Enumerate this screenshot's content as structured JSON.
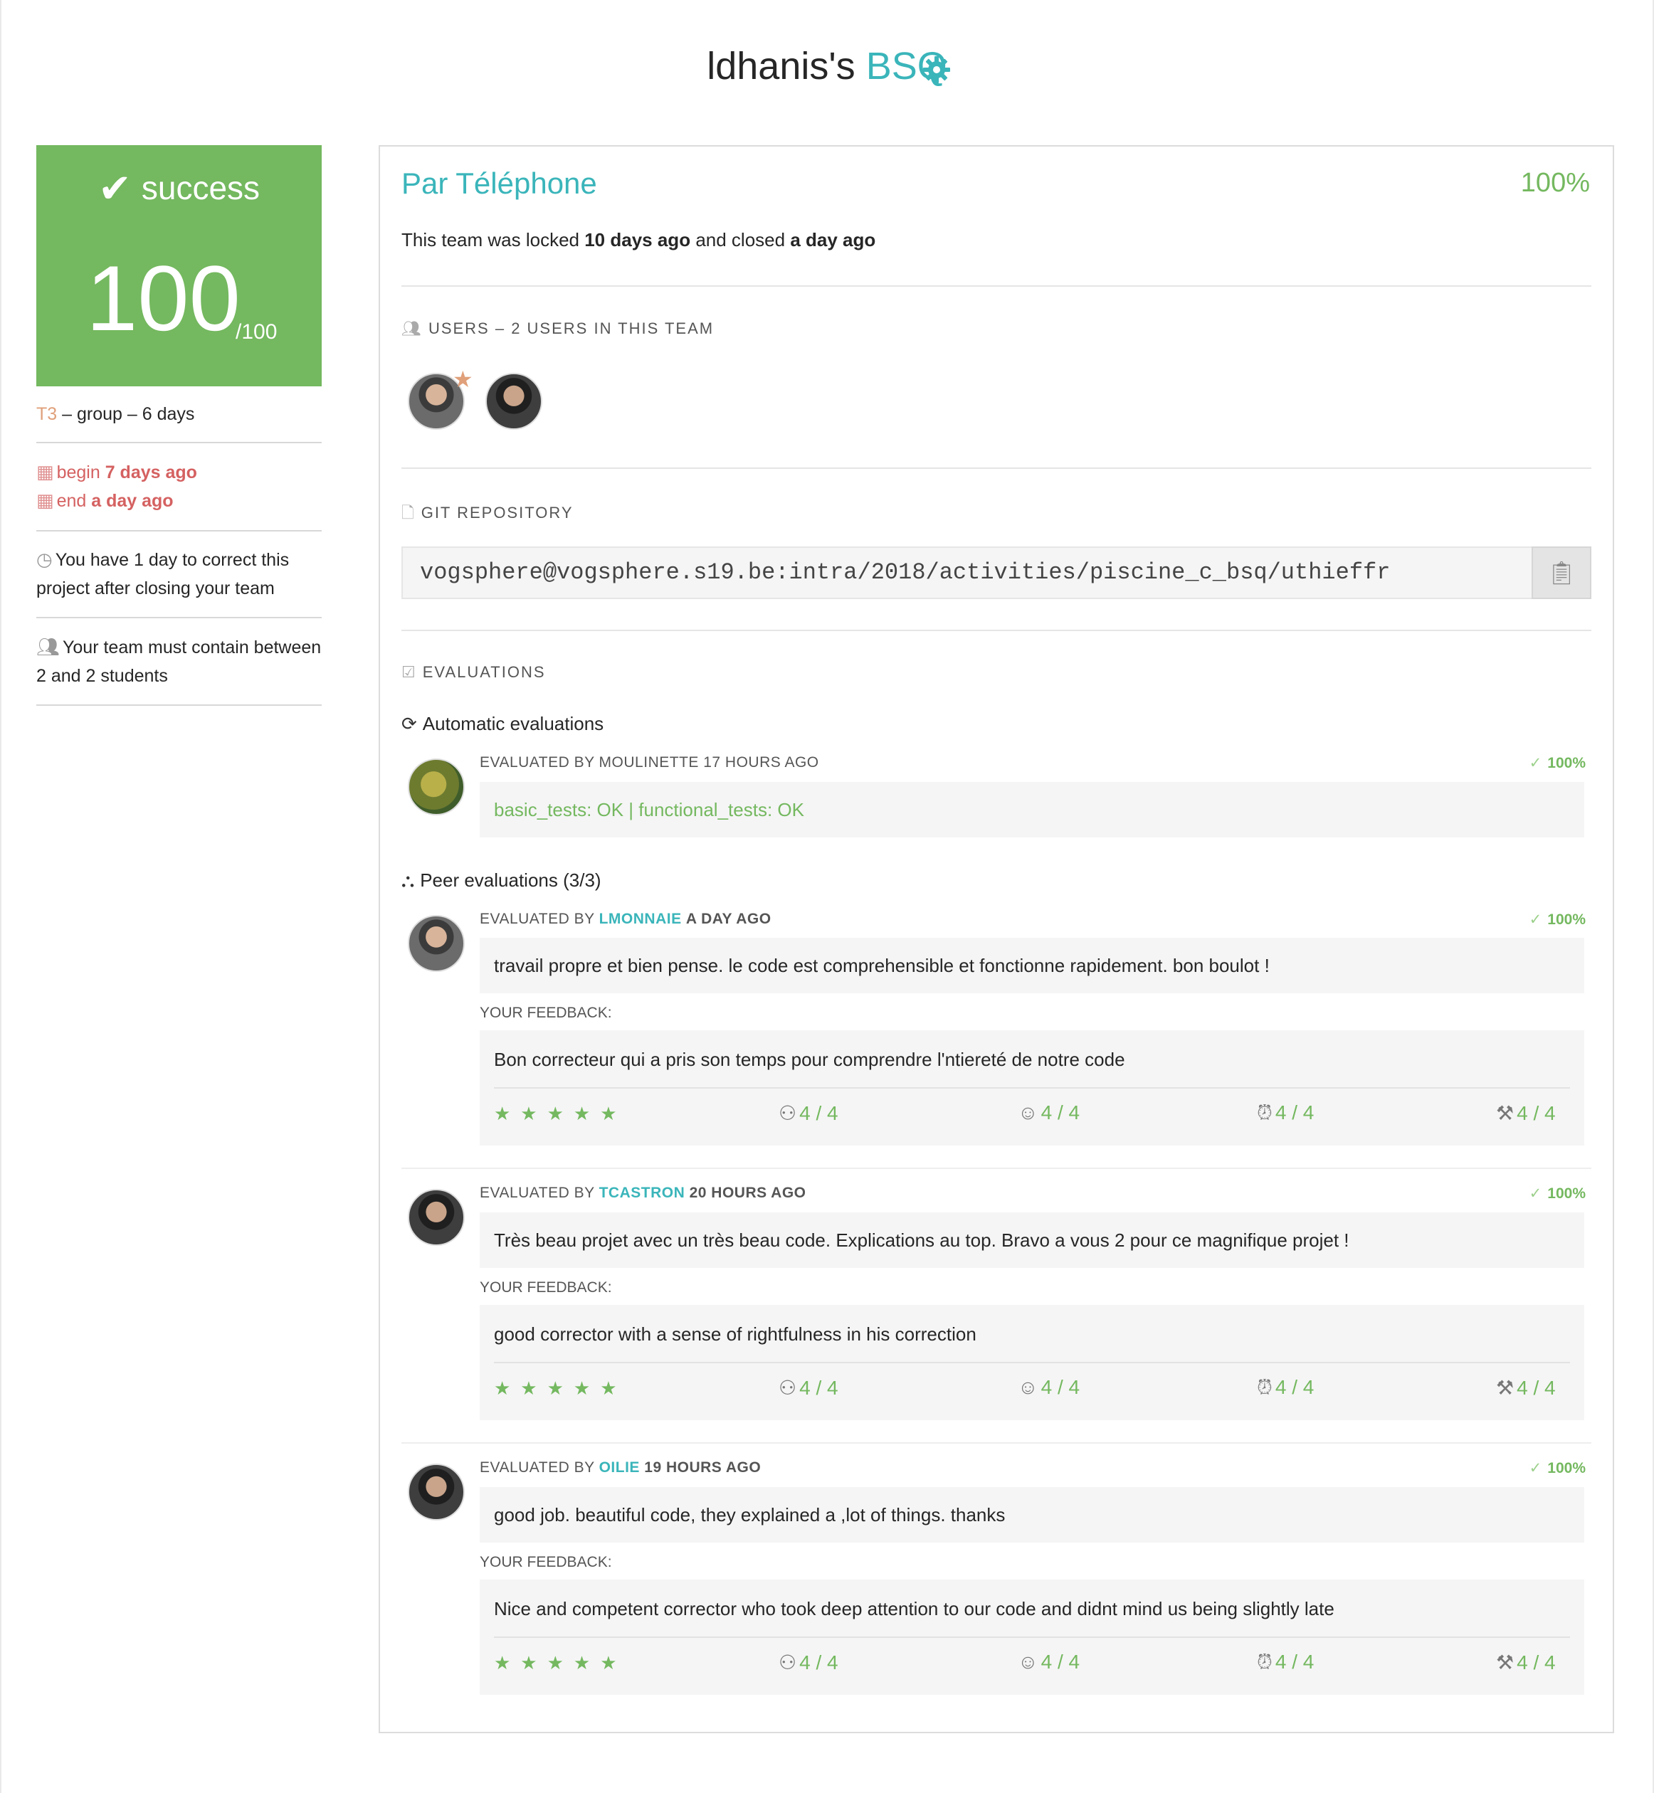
{
  "header": {
    "owner": "ldhanis's",
    "project": "BSQ"
  },
  "left": {
    "status": "success",
    "grade": "100",
    "grade_max": "/100",
    "tier": "T3",
    "meta": " – group – 6 days",
    "begin_label": "begin",
    "begin_value": "7 days ago",
    "end_label": "end",
    "end_value": "a day ago",
    "correct_note_1": "You have 1 day to correct this",
    "correct_note_2": "project after closing your team",
    "team_note_1": "Your team must contain between",
    "team_note_2": "2 and 2 students"
  },
  "team": {
    "name": "Par Téléphone",
    "percent": "100%",
    "status_pre": "This team was locked",
    "locked": "10 days ago",
    "status_mid": "and closed",
    "closed": "a day ago"
  },
  "users_section": {
    "title": "USERS – 2 USERS IN THIS TEAM"
  },
  "git_section": {
    "title": "GIT REPOSITORY",
    "url": "vogsphere@vogsphere.s19.be:intra/2018/activities/piscine_c_bsq/uthieffr"
  },
  "evaluations_section": {
    "title": "EVALUATIONS",
    "automatic_title": "Automatic evaluations",
    "peer_title": "Peer evaluations (3/3)",
    "feedback_label": "YOUR FEEDBACK:"
  },
  "auto_eval": {
    "by": "EVALUATED BY MOULINETTE 17 HOURS AGO",
    "percent": "100%",
    "result": "basic_tests: OK | functional_tests: OK"
  },
  "peer_evals": [
    {
      "prefix": "EVALUATED BY",
      "login": "LMONNAIE",
      "when": "A DAY AGO",
      "percent": "100%",
      "comment": "travail propre et bien pense. le code est comprehensible et fonctionne rapidement. bon boulot !",
      "feedback": "Bon correcteur qui a pris son temps pour comprendre l'ntiereté de notre code",
      "stars": "★★★★★",
      "r1": "4 / 4",
      "r2": "4 / 4",
      "r3": "4 / 4",
      "r4": "4 / 4"
    },
    {
      "prefix": "EVALUATED BY",
      "login": "TCASTRON",
      "when": "20 HOURS AGO",
      "percent": "100%",
      "comment": "Très beau projet avec un très beau code. Explications au top. Bravo a vous 2 pour ce magnifique projet !",
      "feedback": "good corrector with a sense of rightfulness in his correction",
      "stars": "★★★★★",
      "r1": "4 / 4",
      "r2": "4 / 4",
      "r3": "4 / 4",
      "r4": "4 / 4"
    },
    {
      "prefix": "EVALUATED BY",
      "login": "OILIE",
      "when": "19 HOURS AGO",
      "percent": "100%",
      "comment": "good job. beautiful code, they explained a ,lot of things. thanks",
      "feedback": "Nice and competent corrector who took deep attention to our code and didnt mind us being slightly late",
      "stars": "★★★★★",
      "r1": "4 / 4",
      "r2": "4 / 4",
      "r3": "4 / 4",
      "r4": "4 / 4"
    }
  ],
  "colors": {
    "accent": "#3ab5ba",
    "success": "#74b85f",
    "warning": "#d56161",
    "tier": "#e0a07a"
  },
  "icons": {
    "gear": "gear-icon",
    "check": "check-icon",
    "calendar": "calendar-icon",
    "clock": "clock-icon",
    "users": "users-icon",
    "file": "file-icon",
    "clipboard": "clipboard-icon",
    "checkbox": "checkbox-icon",
    "refresh": "refresh-icon",
    "network": "network-icon"
  }
}
